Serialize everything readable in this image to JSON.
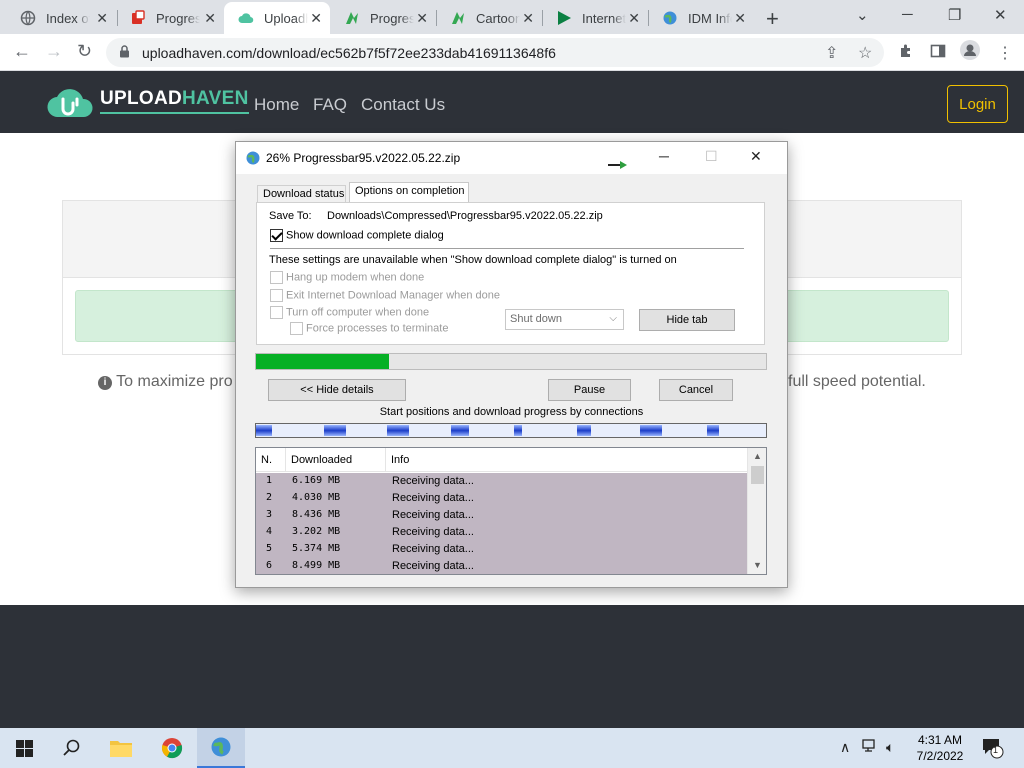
{
  "browser": {
    "tabs": [
      {
        "label": "Index of",
        "icon": "globe-icon"
      },
      {
        "label": "Progress",
        "icon": "pdf-icon"
      },
      {
        "label": "Uploadhaven",
        "icon": "uploadhaven-icon"
      },
      {
        "label": "Progress",
        "icon": "green-leaf-icon"
      },
      {
        "label": "Cartoon",
        "icon": "green-leaf-icon"
      },
      {
        "label": "Internet",
        "icon": "play-icon"
      },
      {
        "label": "IDM Info",
        "icon": "idm-globe-icon"
      }
    ],
    "url": "uploadhaven.com/download/ec562b7f5f72ee233dab4169113648f6"
  },
  "site": {
    "logo_upload": "UPLOAD",
    "logo_haven": "HAVEN",
    "nav": [
      "Home",
      "FAQ",
      "Contact Us"
    ],
    "login": "Login",
    "info_left": "To maximize pro",
    "info_right": "full speed potential."
  },
  "dialog": {
    "title": "26% Progressbar95.v2022.05.22.zip",
    "tabs": [
      "Download status",
      "Options on completion"
    ],
    "save_to_label": "Save To:",
    "save_to_path": "Downloads\\Compressed\\Progressbar95.v2022.05.22.zip",
    "show_complete_label": "Show download complete dialog",
    "show_complete_checked": true,
    "unavailable_note": "These settings are unavailable when \"Show download complete dialog\" is turned on",
    "hang_up": "Hang up modem when done",
    "exit_idm": "Exit Internet Download Manager when done",
    "turn_off": "Turn off computer when done",
    "force_processes": "Force processes to terminate",
    "shutdown_option": "Shut down",
    "hide_tab": "Hide tab",
    "progress_fraction": 0.26,
    "hide_details": "<< Hide details",
    "pause": "Pause",
    "cancel": "Cancel",
    "connections_caption": "Start positions and download progress by connections",
    "list_headers": [
      "N.",
      "Downloaded",
      "Info"
    ],
    "rows": [
      {
        "n": "1",
        "downloaded": "6.169  MB",
        "info": "Receiving data..."
      },
      {
        "n": "2",
        "downloaded": "4.030  MB",
        "info": "Receiving data..."
      },
      {
        "n": "3",
        "downloaded": "8.436  MB",
        "info": "Receiving data..."
      },
      {
        "n": "4",
        "downloaded": "3.202  MB",
        "info": "Receiving data..."
      },
      {
        "n": "5",
        "downloaded": "5.374  MB",
        "info": "Receiving data..."
      },
      {
        "n": "6",
        "downloaded": "8.499  MB",
        "info": "Receiving data..."
      }
    ]
  },
  "taskbar": {
    "time": "4:31 AM",
    "date": "7/2/2022",
    "notification_count": "1"
  },
  "colors": {
    "site_header": "#2d3138",
    "accent_green": "#4fc3a1",
    "login_yellow": "#f0c000",
    "progress_green": "#06b025"
  }
}
